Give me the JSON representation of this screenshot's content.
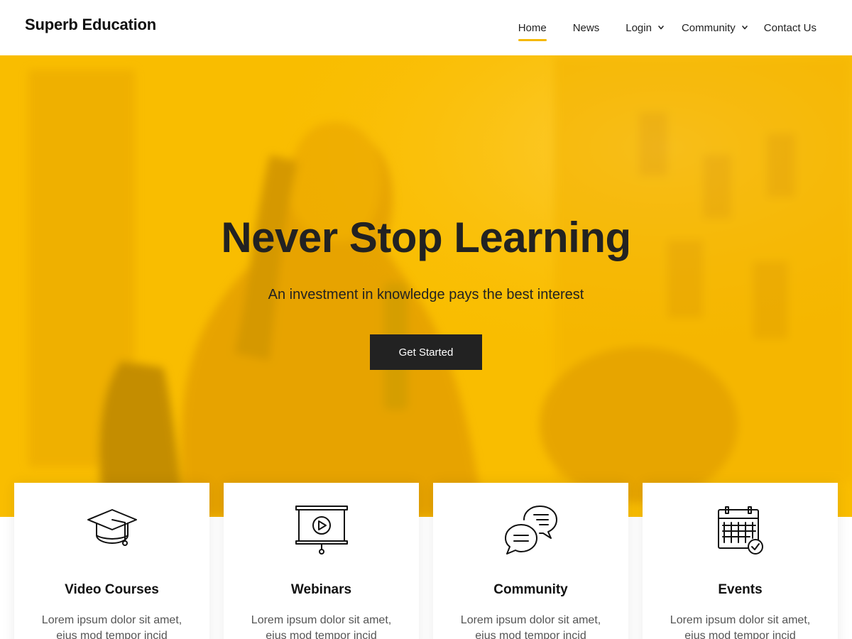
{
  "header": {
    "brand": "Superb Education",
    "nav": [
      {
        "label": "Home",
        "active": true,
        "dropdown": false
      },
      {
        "label": "News",
        "active": false,
        "dropdown": false
      },
      {
        "label": "Login",
        "active": false,
        "dropdown": true
      },
      {
        "label": "Community",
        "active": false,
        "dropdown": true
      },
      {
        "label": "Contact Us",
        "active": false,
        "dropdown": false
      }
    ]
  },
  "hero": {
    "title": "Never Stop Learning",
    "subtitle": "An investment in knowledge pays the best interest",
    "button_label": "Get Started",
    "overlay_color": "#f9bd00"
  },
  "features": [
    {
      "title": "Video Courses",
      "text": "Lorem ipsum dolor sit amet, eius mod tempor incid",
      "icon": "graduation-cap-icon"
    },
    {
      "title": "Webinars",
      "text": "Lorem ipsum dolor sit amet, eius mod tempor incid",
      "icon": "presentation-screen-icon"
    },
    {
      "title": "Community",
      "text": "Lorem ipsum dolor sit amet, eius mod tempor incid",
      "icon": "chat-bubbles-icon"
    },
    {
      "title": "Events",
      "text": "Lorem ipsum dolor sit amet, eius mod tempor incid",
      "icon": "calendar-check-icon"
    }
  ],
  "colors": {
    "accent": "#f5b800",
    "dark": "#222222"
  }
}
